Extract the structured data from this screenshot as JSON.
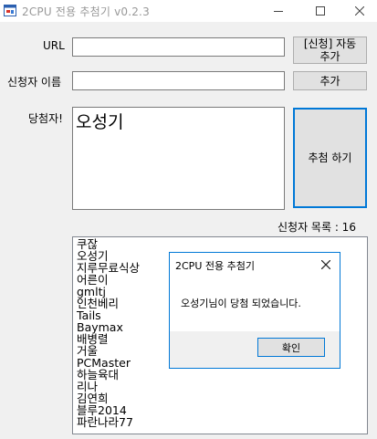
{
  "window": {
    "title": "2CPU 전용 추첨기 v0.2.3",
    "icons": [
      "app-icon",
      "minimize-icon",
      "maximize-icon",
      "close-icon"
    ]
  },
  "form": {
    "url_label": "URL",
    "url_value": "",
    "applicant_label": "신청자 이름",
    "applicant_value": "",
    "auto_add_button": "[신청] 자동\n추가",
    "add_button": "추가",
    "winner_label": "당첨자!",
    "winner_value": "오성기",
    "draw_button": "추첨 하기",
    "count_label": "신청자 목록 : 16"
  },
  "applicants": [
    "쿠잖",
    "오성기",
    "지루무료식상",
    "어른이",
    "gmltj",
    "인천베리",
    "Tails",
    "Baymax",
    "배병렬",
    "거울",
    "PCMaster",
    "하늘육대",
    "리나",
    "김연희",
    "블루2014",
    "파란나라77"
  ],
  "dialog": {
    "title": "2CPU 전용 추첨기",
    "message": "오성기님이 당첨 되었습니다.",
    "ok_button": "확인"
  }
}
